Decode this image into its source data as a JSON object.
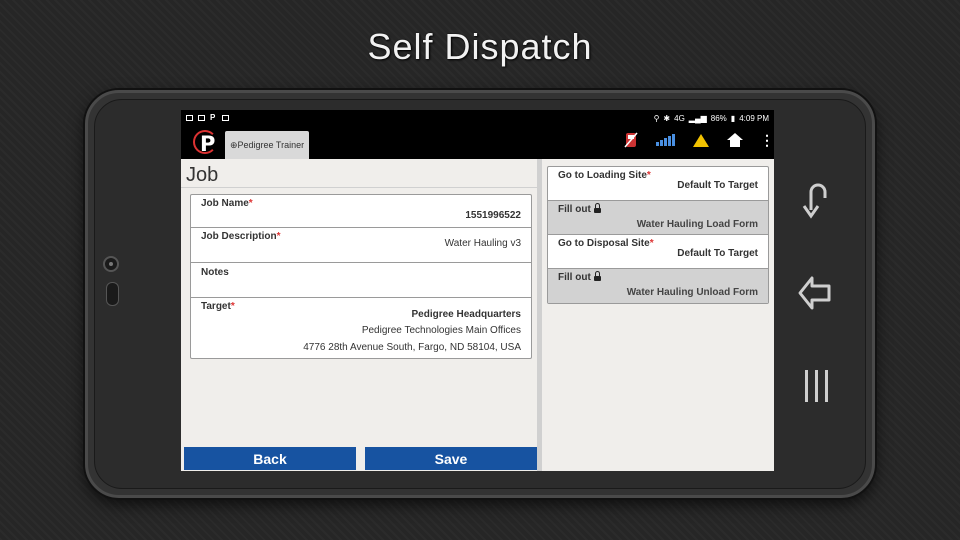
{
  "slide": {
    "title": "Self Dispatch"
  },
  "status_bar": {
    "battery": "86%",
    "time": "4:09 PM",
    "network": "4G"
  },
  "app_bar": {
    "logo_letter": "P",
    "tab_label": "⊕Pedigree Trainer"
  },
  "job": {
    "heading": "Job",
    "name_label": "Job Name",
    "name_value": "1551996522",
    "description_label": "Job Description",
    "description_value": "Water Hauling v3",
    "notes_label": "Notes",
    "target_label": "Target",
    "target_name": "Pedigree Headquarters",
    "target_org": "Pedigree Technologies Main Offices",
    "target_address": "4776 28th Avenue South, Fargo, ND 58104, USA",
    "required_mark": "*"
  },
  "tasks": {
    "loading_label": "Go to Loading Site",
    "loading_value": "Default To Target",
    "fill_out_label_1": "Fill out",
    "loading_form": "Water Hauling Load Form",
    "disposal_label": "Go to Disposal Site",
    "disposal_value": "Default To Target",
    "fill_out_label_2": "Fill out",
    "unload_form": "Water Hauling Unload Form"
  },
  "buttons": {
    "back": "Back",
    "save": "Save"
  },
  "colors": {
    "primary_button": "#1753a1",
    "required": "#dd3333",
    "warning": "#f2c200"
  }
}
